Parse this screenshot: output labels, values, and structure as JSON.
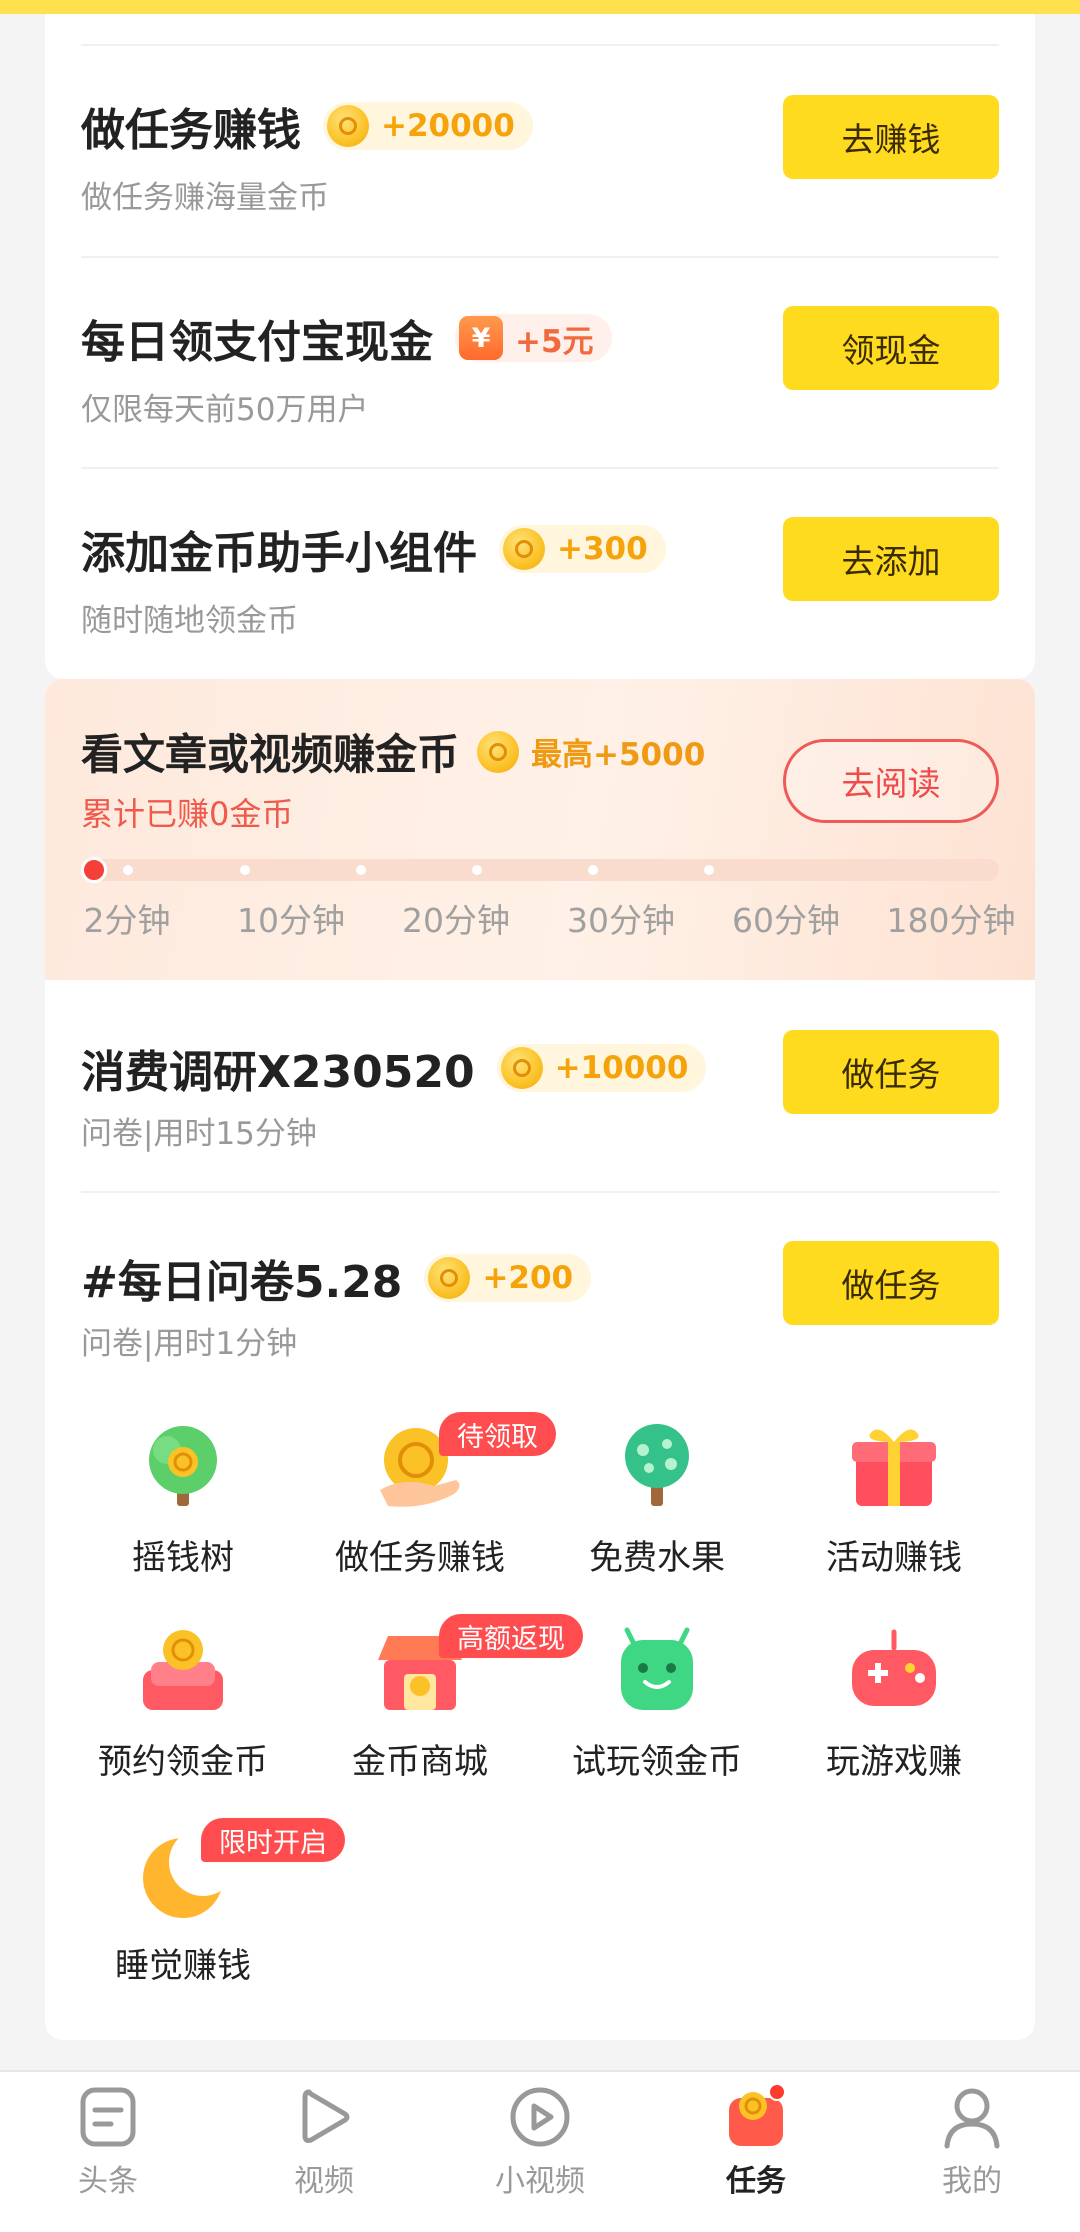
{
  "tasks_top": [
    {
      "title": "做任务赚钱",
      "reward": "+20000",
      "subtitle": "做任务赚海量金币",
      "button": "去赚钱"
    },
    {
      "title": "每日领支付宝现金",
      "reward": "+5元",
      "reward_icon": "¥",
      "subtitle": "仅限每天前50万用户",
      "button": "领现金"
    },
    {
      "title": "添加金币助手小组件",
      "reward": "+300",
      "subtitle": "随时随地领金币",
      "button": "去添加"
    }
  ],
  "read_task": {
    "title": "看文章或视频赚金币",
    "reward": "最高+5000",
    "subtitle": "累计已赚0金币",
    "button": "去阅读",
    "progress": 0,
    "ticks": [
      "2分钟",
      "10分钟",
      "20分钟",
      "30分钟",
      "60分钟",
      "180分钟"
    ]
  },
  "tasks_bottom": [
    {
      "title": "消费调研X230520",
      "reward": "+10000",
      "subtitle": "问卷|用时15分钟",
      "button": "做任务"
    },
    {
      "title": "#每日问卷5.28",
      "reward": "+200",
      "subtitle": "问卷|用时1分钟",
      "button": "做任务"
    }
  ],
  "grid": [
    {
      "label": "摇钱树",
      "icon": "money-tree-icon"
    },
    {
      "label": "做任务赚钱",
      "icon": "coin-hand-icon",
      "badge": "待领取"
    },
    {
      "label": "免费水果",
      "icon": "fruit-tree-icon"
    },
    {
      "label": "活动赚钱",
      "icon": "gift-box-icon"
    },
    {
      "label": "预约领金币",
      "icon": "coin-sofa-icon"
    },
    {
      "label": "金币商城",
      "icon": "coin-shop-icon",
      "badge": "高额返现"
    },
    {
      "label": "试玩领金币",
      "icon": "android-icon"
    },
    {
      "label": "玩游戏赚",
      "icon": "gamepad-icon"
    },
    {
      "label": "睡觉赚钱",
      "icon": "moon-icon",
      "badge": "限时开启"
    }
  ],
  "tabs": [
    {
      "label": "头条",
      "icon": "news-icon",
      "active": false
    },
    {
      "label": "视频",
      "icon": "video-play-icon",
      "active": false
    },
    {
      "label": "小视频",
      "icon": "short-video-icon",
      "active": false
    },
    {
      "label": "任务",
      "icon": "task-icon",
      "active": true
    },
    {
      "label": "我的",
      "icon": "profile-icon",
      "active": false
    }
  ],
  "colors": {
    "accent_yellow": "#fedb1f",
    "coin_orange": "#f6a20a",
    "red": "#ef5a4a"
  }
}
